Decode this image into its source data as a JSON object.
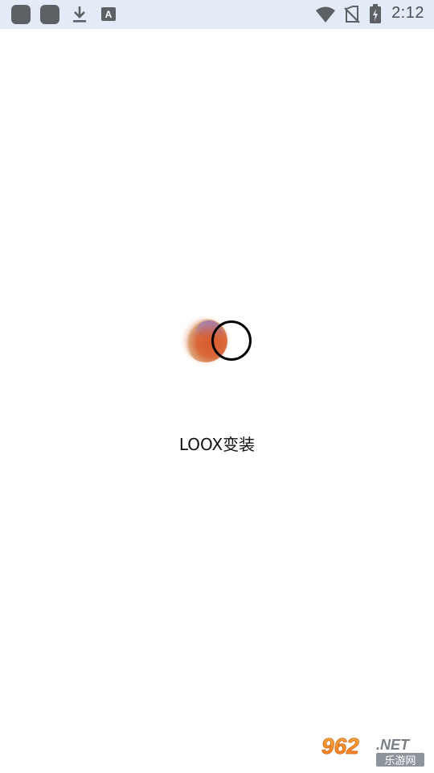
{
  "status_bar": {
    "time": "2:12",
    "left_icons": [
      "app-icon",
      "app-icon",
      "download-icon",
      "font-a-icon"
    ],
    "right_icons": [
      "wifi-icon",
      "no-sim-icon",
      "battery-charging-icon"
    ]
  },
  "splash": {
    "app_name": "LOOX变装"
  },
  "watermark": {
    "number": "962",
    "suffix": ".NET",
    "tagline": "乐游网"
  },
  "colors": {
    "status_bar_bg": "#e3ecf6",
    "logo_orange": "#d9643a",
    "logo_purple": "#9a74b6"
  }
}
